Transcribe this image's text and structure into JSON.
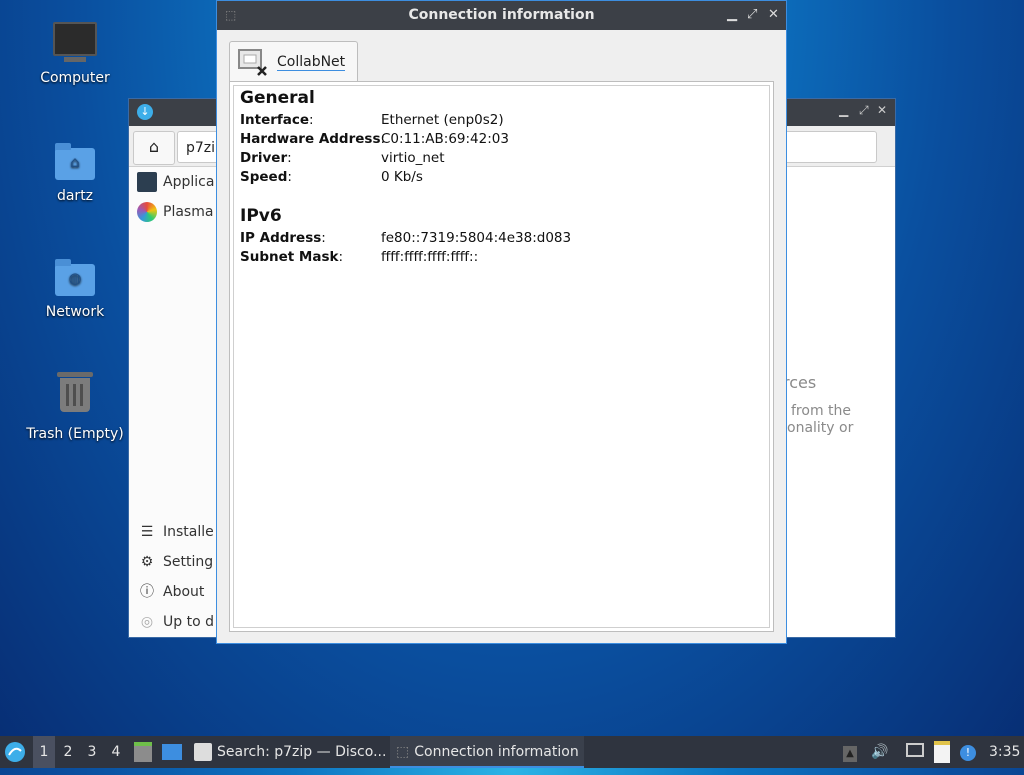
{
  "desktop": {
    "icons": [
      {
        "label": "Computer"
      },
      {
        "label": "dartz"
      },
      {
        "label": "Network"
      },
      {
        "label": "Trash (Empty)"
      }
    ]
  },
  "discover": {
    "search_value": "p7zip",
    "sidebar": {
      "top_items": [
        "Applica",
        "Plasma"
      ],
      "bottom_items": [
        "Installe",
        "Setting",
        "About",
        "Up to d"
      ]
    },
    "bg_text": {
      "heading": "rces",
      "line1": "from the",
      "line2": "onality or"
    }
  },
  "dialog": {
    "title": "Connection information",
    "tab_label": "CollabNet",
    "general": {
      "heading": "General",
      "rows": [
        {
          "key": "Interface",
          "value": "Ethernet (enp0s2)"
        },
        {
          "key": "Hardware Address",
          "value": "C0:11:AB:69:42:03"
        },
        {
          "key": "Driver",
          "value": "virtio_net"
        },
        {
          "key": "Speed",
          "value": "0 Kb/s"
        }
      ]
    },
    "ipv6": {
      "heading": "IPv6",
      "rows": [
        {
          "key": "IP Address",
          "value": "fe80::7319:5804:4e38:d083"
        },
        {
          "key": "Subnet Mask",
          "value": "ffff:ffff:ffff:ffff::"
        }
      ]
    }
  },
  "taskbar": {
    "workspaces": [
      "1",
      "2",
      "3",
      "4"
    ],
    "tasks": [
      "Search: p7zip — Disco...",
      "Connection information"
    ],
    "clock": "3:35"
  },
  "colors": {
    "accent": "#3d8ee0",
    "titlebar": "#3c4047",
    "taskbar": "#2f343f"
  }
}
